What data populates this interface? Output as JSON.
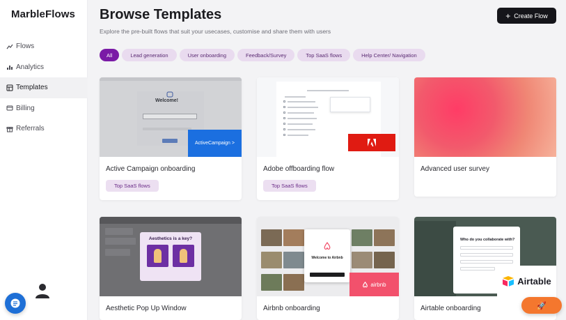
{
  "sidebar": {
    "brand": "MarbleFlows",
    "items": [
      {
        "label": "Flows",
        "icon": "flows-icon"
      },
      {
        "label": "Analytics",
        "icon": "analytics-icon"
      },
      {
        "label": "Templates",
        "icon": "templates-icon",
        "active": true
      },
      {
        "label": "Billing",
        "icon": "billing-icon"
      },
      {
        "label": "Referrals",
        "icon": "referrals-icon"
      }
    ]
  },
  "header": {
    "title": "Browse Templates",
    "subtitle": "Explore the pre-built flows that suit your usecases, customise and share them with users",
    "create_label": "Create Flow"
  },
  "filters": [
    "All",
    "Lead generation",
    "User onboarding",
    "Feedback/Survey",
    "Top SaaS flows",
    "Help Center/ Navigation"
  ],
  "cards": [
    {
      "title": "Active Campaign onboarding",
      "tag": "Top SaaS flows",
      "thumb_text": "Welcome!",
      "brand": "ActiveCampaign >"
    },
    {
      "title": "Adobe offboarding flow",
      "tag": "Top SaaS flows",
      "brand": "Adobe"
    },
    {
      "title": "Advanced user survey"
    },
    {
      "title": "Aesthetic Pop Up Window",
      "thumb_text": "Aesthetics is a key?"
    },
    {
      "title": "Airbnb onboarding",
      "thumb_text": "Welcome to Airbnb",
      "brand": "airbnb"
    },
    {
      "title": "Airtable onboarding",
      "thumb_text": "Who do you collaborate with?",
      "brand": "Airtable"
    }
  ],
  "colors": {
    "accent": "#7a1aa6",
    "chip": "#e9dbef",
    "dark_button": "#15151a",
    "chat": "#1e6fd6",
    "launcher": "#f4772e"
  }
}
